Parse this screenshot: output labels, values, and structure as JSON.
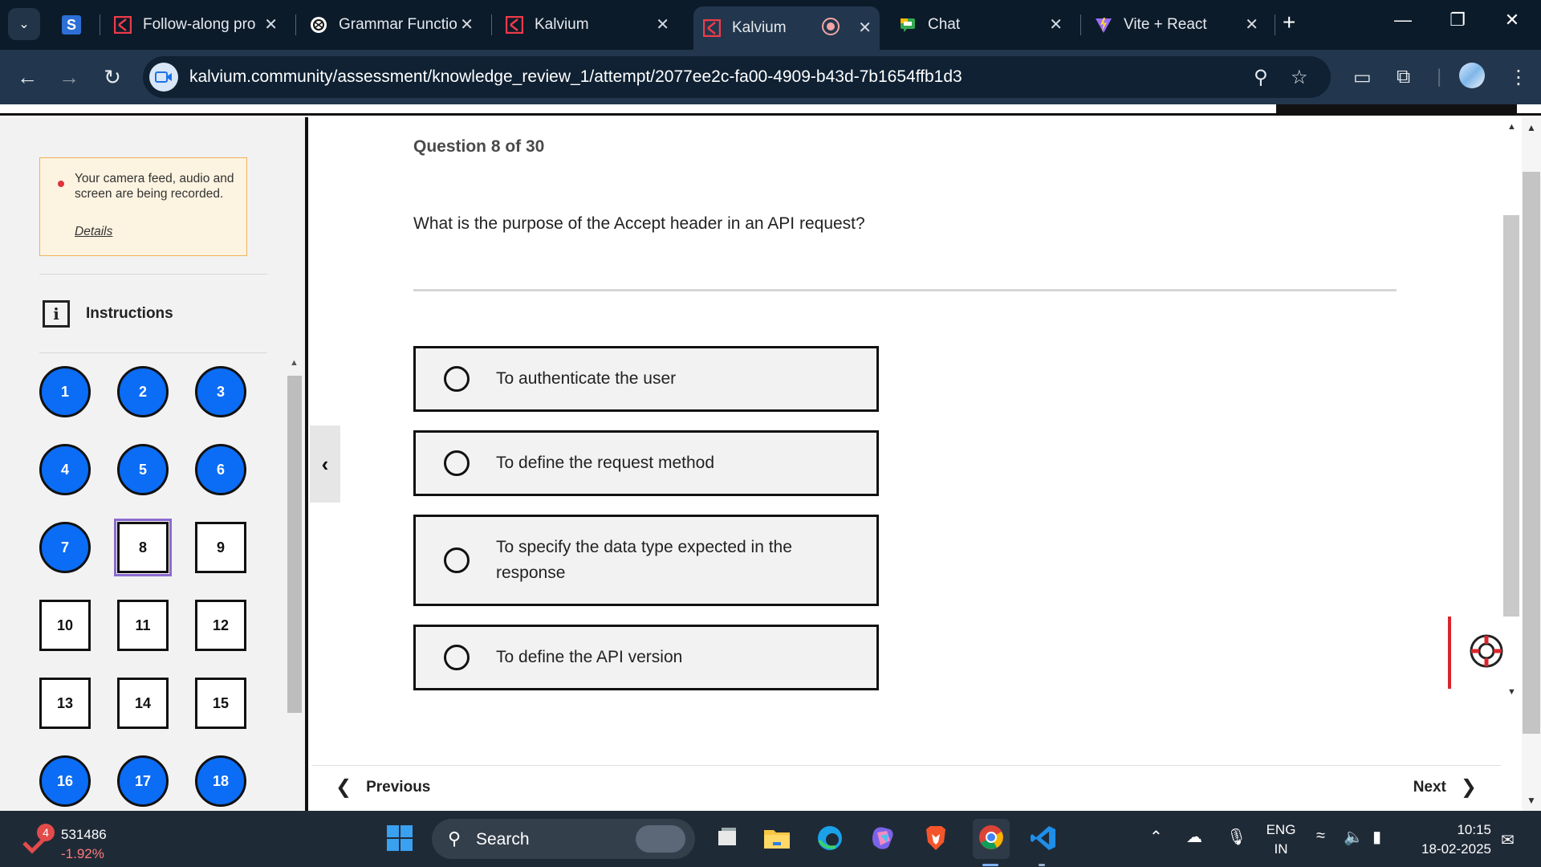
{
  "browser": {
    "tabs": [
      {
        "label": "Follow-along pro",
        "icon": "kalvium-icon",
        "active": false
      },
      {
        "label": "Grammar Functio",
        "icon": "openai-icon",
        "active": false
      },
      {
        "label": "Kalvium",
        "icon": "kalvium-icon",
        "active": false
      },
      {
        "label": "Kalvium",
        "icon": "kalvium-icon",
        "active": true,
        "recording": true
      },
      {
        "label": "Chat",
        "icon": "chat-icon",
        "active": false
      },
      {
        "label": "Vite + React",
        "icon": "vite-icon",
        "active": false
      }
    ],
    "pinned_tab_icon": "S",
    "new_tab": "+",
    "close_glyph": "✕",
    "url": "kalvium.community/assessment/knowledge_review_1/attempt/2077ee2c-fa00-4909-b43d-7b1654ffb1d3"
  },
  "sidebar": {
    "notice": {
      "message": "Your camera feed, audio and screen are being recorded.",
      "details_label": "Details"
    },
    "instructions_icon": "i",
    "instructions_label": "Instructions",
    "questions": [
      {
        "n": "1",
        "state": "answered"
      },
      {
        "n": "2",
        "state": "answered"
      },
      {
        "n": "3",
        "state": "answered"
      },
      {
        "n": "4",
        "state": "answered"
      },
      {
        "n": "5",
        "state": "answered"
      },
      {
        "n": "6",
        "state": "answered"
      },
      {
        "n": "7",
        "state": "answered"
      },
      {
        "n": "8",
        "state": "current"
      },
      {
        "n": "9",
        "state": "pending"
      },
      {
        "n": "10",
        "state": "pending"
      },
      {
        "n": "11",
        "state": "pending"
      },
      {
        "n": "12",
        "state": "pending"
      },
      {
        "n": "13",
        "state": "pending"
      },
      {
        "n": "14",
        "state": "pending"
      },
      {
        "n": "15",
        "state": "pending"
      },
      {
        "n": "16",
        "state": "answered"
      },
      {
        "n": "17",
        "state": "answered"
      },
      {
        "n": "18",
        "state": "answered"
      }
    ]
  },
  "main": {
    "question_number": "Question 8 of 30",
    "question_text": "What is the purpose of the Accept header in an API request?",
    "options": [
      "To authenticate the user",
      "To define the request method",
      "To specify the data type expected in the response",
      "To define the API version"
    ],
    "previous_label": "Previous",
    "next_label": "Next"
  },
  "taskbar": {
    "stock_badge": "4",
    "stock_value": "531486",
    "stock_change": "-1.92%",
    "search_label": "Search",
    "language": "ENG",
    "region": "IN",
    "time": "10:15",
    "date": "18-02-2025"
  },
  "colors": {
    "answered": "#0b6cf5",
    "current_outline": "#8c6ad0",
    "notice_bg": "#fdf3e1",
    "notice_border": "#f0b25a",
    "help_accent": "#d9262e"
  }
}
